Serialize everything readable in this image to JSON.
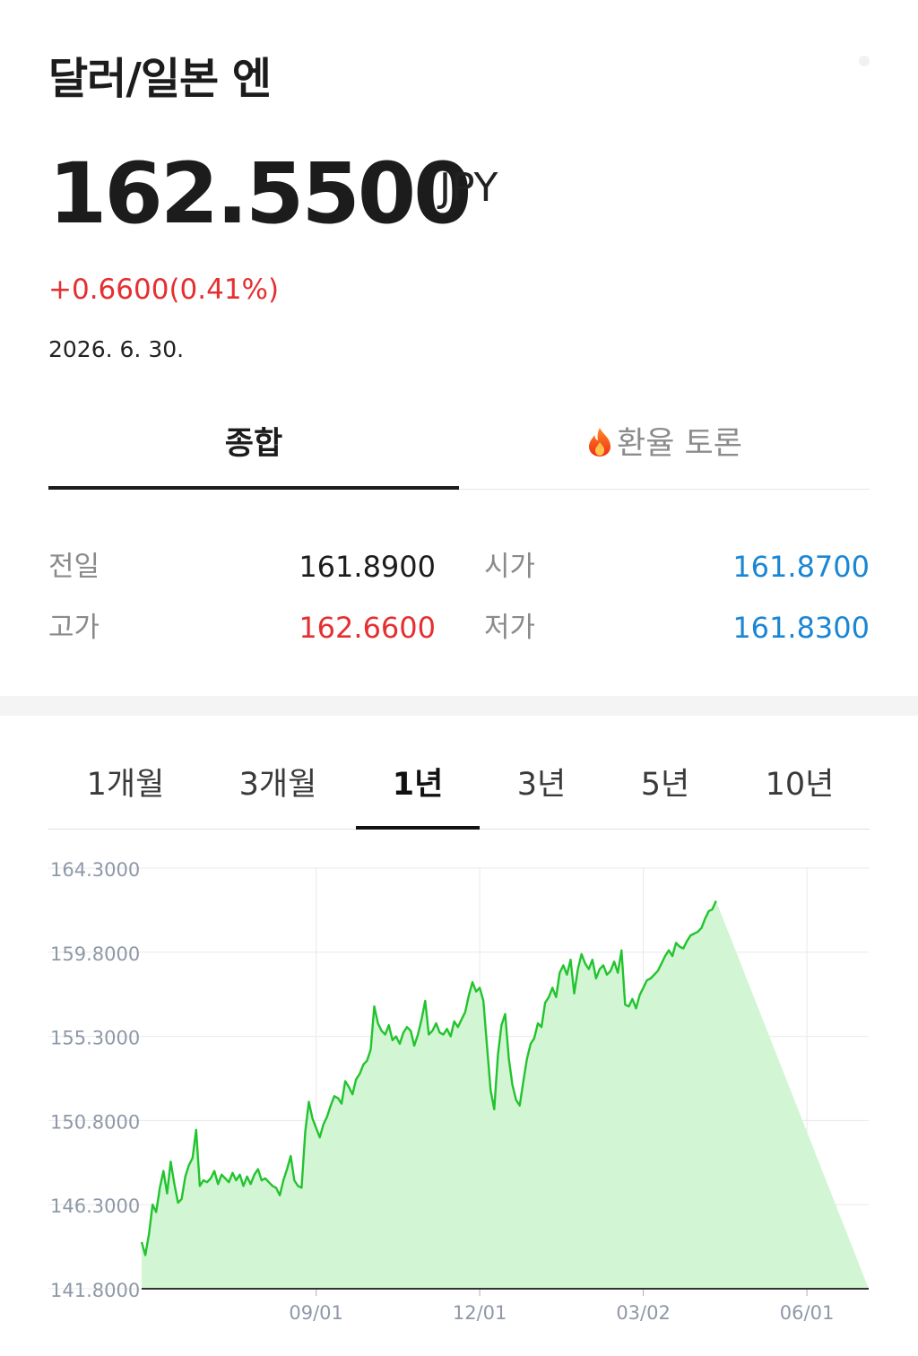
{
  "header": {
    "title": "달러/일본 엔",
    "price": "162.5500",
    "unit": "JPY",
    "change": "+0.6600(0.41%)",
    "date": "2026. 6. 30."
  },
  "tabs": [
    {
      "label": "종합",
      "active": true
    },
    {
      "label": "환율 토론",
      "active": false,
      "icon": "fire-icon"
    }
  ],
  "stats": {
    "prev_close": {
      "label": "전일",
      "value": "161.8900"
    },
    "open": {
      "label": "시가",
      "value": "161.8700"
    },
    "high": {
      "label": "고가",
      "value": "162.6600"
    },
    "low": {
      "label": "저가",
      "value": "161.8300"
    }
  },
  "periods": [
    {
      "label": "1개월",
      "active": false
    },
    {
      "label": "3개월",
      "active": false
    },
    {
      "label": "1년",
      "active": true
    },
    {
      "label": "3년",
      "active": false
    },
    {
      "label": "5년",
      "active": false
    },
    {
      "label": "10년",
      "active": false
    }
  ],
  "colors": {
    "up": "#e52f31",
    "down": "#1a86d4",
    "line": "#22c42e",
    "fill": "#d2f5d3"
  },
  "chart_data": {
    "type": "area",
    "ylim": [
      141.8,
      164.3
    ],
    "yticks": [
      "164.3000",
      "159.8000",
      "155.3000",
      "150.8000",
      "146.3000",
      "141.8000"
    ],
    "xticks": [
      {
        "label": "09/01",
        "pos": 0.24
      },
      {
        "label": "12/01",
        "pos": 0.465
      },
      {
        "label": "03/02",
        "pos": 0.69
      },
      {
        "label": "06/01",
        "pos": 0.915
      }
    ],
    "grid": true,
    "x": [
      0,
      0.005,
      0.01,
      0.015,
      0.02,
      0.025,
      0.03,
      0.035,
      0.04,
      0.045,
      0.05,
      0.055,
      0.06,
      0.065,
      0.07,
      0.075,
      0.08,
      0.085,
      0.09,
      0.095,
      0.1,
      0.105,
      0.11,
      0.115,
      0.12,
      0.125,
      0.13,
      0.135,
      0.14,
      0.145,
      0.15,
      0.155,
      0.16,
      0.165,
      0.17,
      0.175,
      0.18,
      0.185,
      0.19,
      0.195,
      0.2,
      0.205,
      0.21,
      0.215,
      0.22,
      0.225,
      0.23,
      0.235,
      0.24,
      0.245,
      0.25,
      0.255,
      0.26,
      0.265,
      0.27,
      0.275,
      0.28,
      0.285,
      0.29,
      0.295,
      0.3,
      0.305,
      0.31,
      0.315,
      0.32,
      0.325,
      0.33,
      0.335,
      0.34,
      0.345,
      0.35,
      0.355,
      0.36,
      0.365,
      0.37,
      0.375,
      0.38,
      0.385,
      0.39,
      0.395,
      0.4,
      0.405,
      0.41,
      0.415,
      0.42,
      0.425,
      0.43,
      0.435,
      0.44,
      0.445,
      0.45,
      0.455,
      0.46,
      0.465,
      0.47,
      0.475,
      0.48,
      0.485,
      0.49,
      0.495,
      0.5,
      0.505,
      0.51,
      0.515,
      0.52,
      0.525,
      0.53,
      0.535,
      0.54,
      0.545,
      0.55,
      0.555,
      0.56,
      0.565,
      0.57,
      0.575,
      0.58,
      0.585,
      0.59,
      0.595,
      0.6,
      0.605,
      0.61,
      0.615,
      0.62,
      0.625,
      0.63,
      0.635,
      0.64,
      0.645,
      0.65,
      0.655,
      0.66,
      0.665,
      0.67,
      0.675,
      0.68,
      0.685,
      0.69,
      0.695,
      0.7,
      0.705,
      0.71,
      0.715,
      0.72,
      0.725,
      0.73,
      0.735,
      0.74,
      0.745,
      0.75,
      0.755,
      0.76,
      0.765,
      0.77,
      0.775,
      0.78,
      0.785,
      0.79,
      0.795,
      0.8,
      0.805,
      0.81,
      0.815,
      0.82,
      0.825,
      0.83,
      0.835,
      0.84,
      0.845,
      0.85,
      0.855,
      0.86,
      0.865,
      0.87,
      0.875,
      0.88,
      0.885,
      0.89,
      0.895,
      0.9,
      0.905,
      0.91,
      0.915,
      0.92,
      0.925,
      0.93,
      0.935,
      0.94,
      0.945,
      0.95,
      0.955,
      0.96,
      0.965,
      0.97,
      0.975,
      0.98,
      0.985,
      0.99,
      0.995,
      1
    ],
    "series": [
      {
        "values": [
          144.3,
          143.6,
          144.7,
          146.3,
          145.9,
          147.2,
          148.1,
          146.9,
          148.6,
          147.4,
          146.4,
          146.6,
          147.8,
          148.4,
          148.8,
          150.3,
          147.3,
          147.6,
          147.5,
          147.7,
          148.1,
          147.4,
          147.9,
          147.7,
          147.5,
          148.0,
          147.6,
          147.9,
          147.3,
          147.8,
          147.4,
          147.9,
          148.2,
          147.6,
          147.7,
          147.5,
          147.3,
          147.2,
          146.8,
          147.6,
          148.2,
          148.9,
          147.6,
          147.3,
          147.2,
          150.2,
          151.8,
          150.9,
          150.4,
          149.9,
          150.6,
          151.0,
          151.6,
          152.1,
          152.0,
          151.7,
          152.9,
          152.6,
          152.2,
          153.0,
          153.3,
          153.8,
          154.0,
          154.6,
          156.9,
          156.0,
          155.6,
          155.4,
          155.9,
          155.1,
          155.3,
          154.9,
          155.5,
          155.8,
          155.6,
          154.8,
          155.4,
          156.2,
          157.2,
          155.4,
          155.6,
          156.0,
          155.5,
          155.4,
          155.7,
          155.3,
          156.1,
          155.8,
          156.2,
          156.6,
          157.5,
          158.2,
          157.7,
          157.9,
          157.2,
          154.8,
          152.4,
          151.4,
          154.3,
          155.9,
          156.5,
          154.1,
          152.7,
          151.9,
          151.6,
          152.9,
          154.1,
          154.9,
          155.2,
          156.0,
          155.8,
          157.1,
          157.4,
          157.9,
          157.4,
          158.7,
          159.1,
          158.6,
          159.4,
          157.6,
          158.9,
          159.7,
          159.2,
          158.9,
          159.4,
          158.4,
          158.9,
          159.1,
          158.6,
          158.8,
          159.3,
          158.7,
          159.9,
          157.0,
          156.9,
          157.3,
          156.8,
          157.5,
          157.9,
          158.3,
          158.4,
          158.6,
          158.8,
          159.2,
          159.6,
          159.9,
          159.6,
          160.3,
          160.1,
          160.0,
          160.4,
          160.7,
          160.8,
          160.9,
          161.1,
          161.6,
          162.0,
          162.1,
          162.55
        ]
      }
    ]
  }
}
